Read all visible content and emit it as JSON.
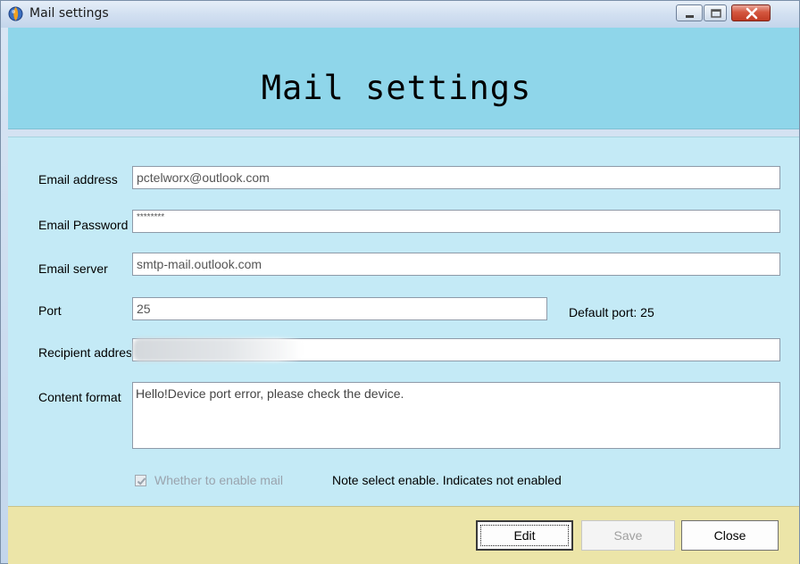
{
  "window": {
    "title": "Mail settings",
    "controls": [
      "minimize",
      "maximize",
      "close"
    ]
  },
  "header": {
    "title": "Mail settings"
  },
  "form": {
    "email_address": {
      "label": "Email address",
      "value": "pctelworx@outlook.com"
    },
    "email_password": {
      "label": "Email Password",
      "value": "********"
    },
    "email_server": {
      "label": "Email server",
      "value": "smtp-mail.outlook.com"
    },
    "port": {
      "label": "Port",
      "value": "25",
      "default_text": "Default port:  25"
    },
    "recipient_address": {
      "label": "Recipient address",
      "value": ""
    },
    "content_format": {
      "label": "Content format",
      "value": "Hello!Device port error, please check the device."
    },
    "enable_mail": {
      "label": "Whether to enable mail",
      "checked": true,
      "disabled": true
    },
    "note": "Note select enable. Indicates not enabled"
  },
  "buttons": {
    "edit": "Edit",
    "save": "Save",
    "close": "Close"
  },
  "colors": {
    "header_bg": "#8fd6ea",
    "panel_bg": "#c4eaf6",
    "footer_bg": "#ece5a8",
    "close_button": "#c13b24"
  },
  "icons": {
    "app": "app-globe-icon",
    "minimize": "minimize-icon",
    "maximize": "maximize-icon",
    "close": "close-icon",
    "checkbox": "checkmark-icon"
  }
}
